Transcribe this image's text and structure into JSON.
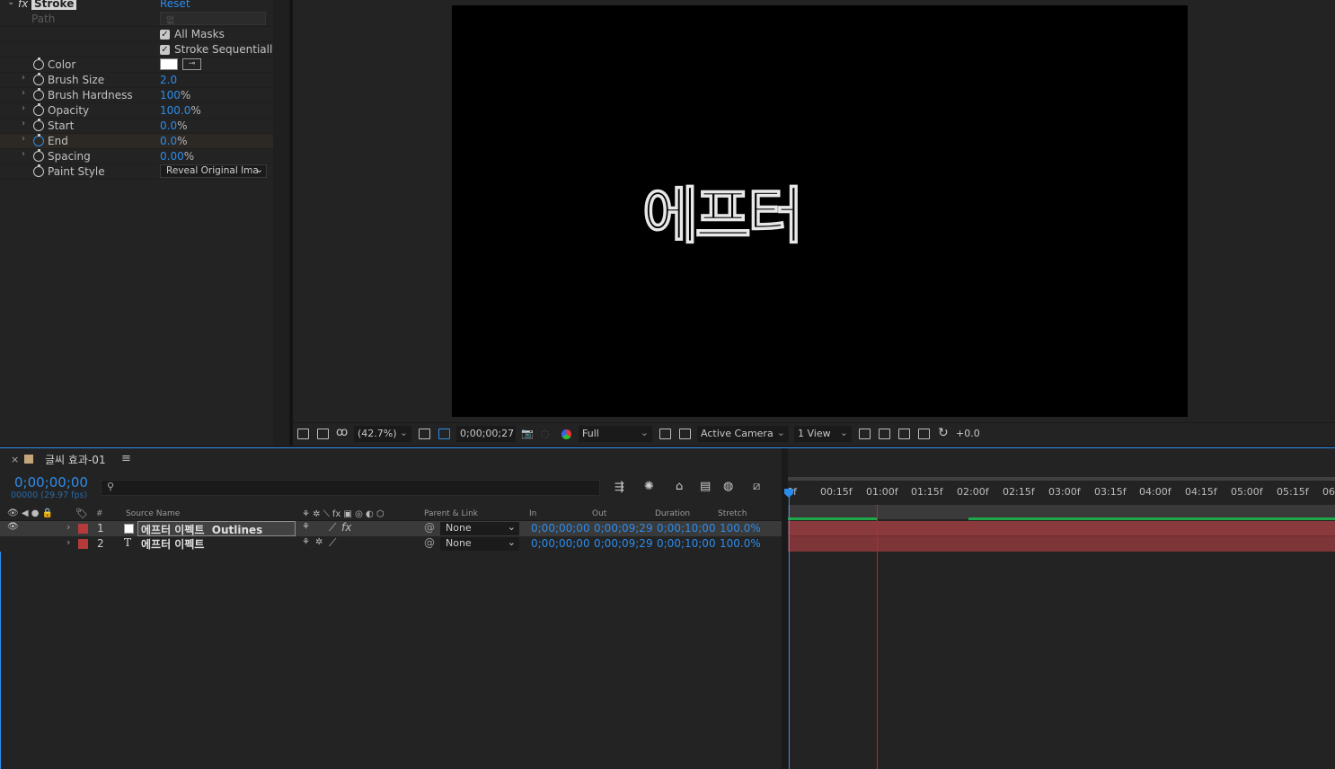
{
  "effect": {
    "fx_label": "fx",
    "name": "Stroke",
    "reset": "Reset",
    "path_label": "Path",
    "path_value": "없",
    "all_masks": "All Masks",
    "stroke_sequentially": "Stroke Sequentiall",
    "params": [
      {
        "label": "Color",
        "value": ""
      },
      {
        "label": "Brush Size",
        "value": "2.0",
        "unit": ""
      },
      {
        "label": "Brush Hardness",
        "value": "100",
        "unit": "%"
      },
      {
        "label": "Opacity",
        "value": "100.0",
        "unit": "%"
      },
      {
        "label": "Start",
        "value": "0.0",
        "unit": "%"
      },
      {
        "label": "End",
        "value": "0.0",
        "unit": "%"
      },
      {
        "label": "Spacing",
        "value": "0.00",
        "unit": "%"
      },
      {
        "label": "Paint Style",
        "value": "Reveal Original Ima"
      }
    ]
  },
  "viewer": {
    "canvas_text": "에프터",
    "zoom": "(42.7%)",
    "timecode": "0;00;00;27",
    "resolution": "Full",
    "camera": "Active Camera",
    "view": "1 View",
    "exposure": "+0.0"
  },
  "timeline": {
    "comp_name": "글씨 효과-01",
    "current_time": "0;00;00;00",
    "frame_info": "00000 (29.97 fps)",
    "headers": {
      "num": "#",
      "source": "Source Name",
      "parent": "Parent & Link",
      "in": "In",
      "out": "Out",
      "duration": "Duration",
      "stretch": "Stretch"
    },
    "layers": [
      {
        "num": "1",
        "name": "에프터 이펙트  Outlines",
        "type_icon": "",
        "parent": "None",
        "in": "0;00;00;00",
        "out": "0;00;09;29",
        "duration": "0;00;10;00",
        "stretch": "100.0%"
      },
      {
        "num": "2",
        "name": "에프터 이펙트",
        "type_icon": "T",
        "parent": "None",
        "in": "0;00;00;00",
        "out": "0;00;09;29",
        "duration": "0;00;10;00",
        "stretch": "100.0%"
      }
    ],
    "ruler": [
      "0f",
      "00:15f",
      "01:00f",
      "01:15f",
      "02:00f",
      "02:15f",
      "03:00f",
      "03:15f",
      "04:00f",
      "04:15f",
      "05:00f",
      "05:15f",
      "06:"
    ]
  },
  "colors": {
    "accent": "#2d8ceb",
    "label_red": "#b63a3a",
    "bar_red": "#8a3a3c",
    "work_area_green": "#1fa84a"
  }
}
